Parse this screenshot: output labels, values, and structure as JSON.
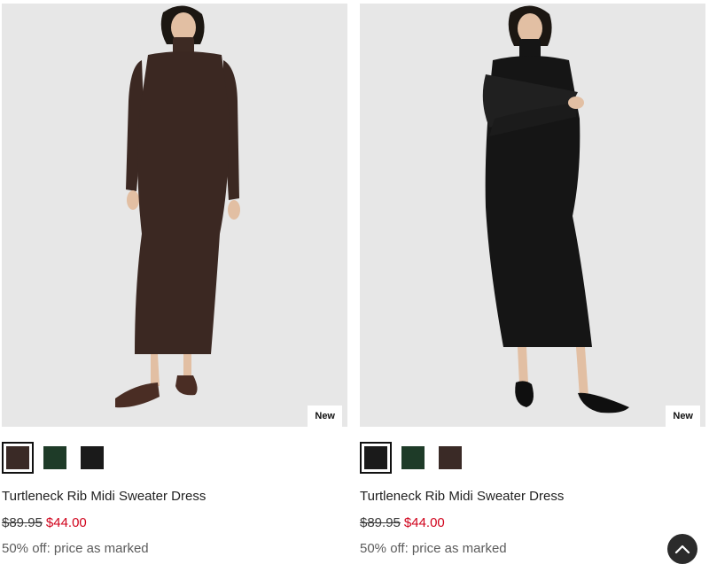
{
  "products": [
    {
      "badge": "New",
      "swatches": [
        {
          "color": "#3a2a26",
          "selected": true
        },
        {
          "color": "#1e3b28",
          "selected": false
        },
        {
          "color": "#1a1a1a",
          "selected": false
        }
      ],
      "title": "Turtleneck Rib Midi Sweater Dress",
      "price_original": "$89.95",
      "price_sale": "$44.00",
      "promo": "50% off: price as marked"
    },
    {
      "badge": "New",
      "swatches": [
        {
          "color": "#1a1a1a",
          "selected": true
        },
        {
          "color": "#1e3b28",
          "selected": false
        },
        {
          "color": "#3a2a26",
          "selected": false
        }
      ],
      "title": "Turtleneck Rib Midi Sweater Dress",
      "price_original": "$89.95",
      "price_sale": "$44.00",
      "promo": "50% off: price as marked"
    }
  ],
  "colors": {
    "sale": "#d0021b",
    "photo_bg": "#e7e7e7"
  },
  "icons": {
    "back_to_top": "chevron-up-icon"
  }
}
